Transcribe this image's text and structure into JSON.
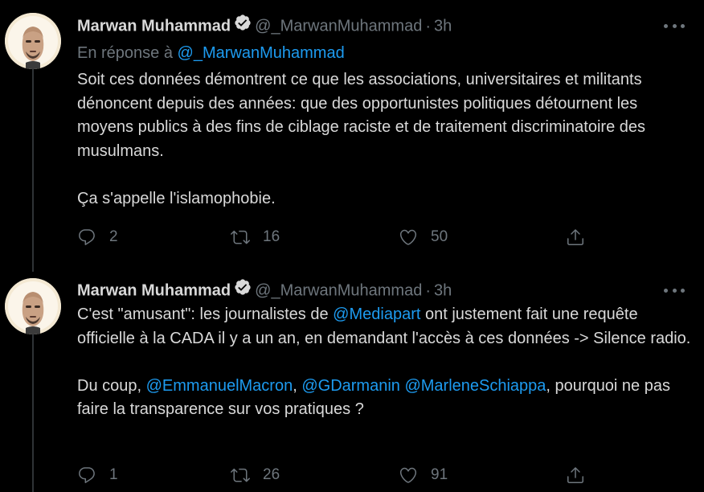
{
  "colors": {
    "background": "#000000",
    "text": "#d9d9d9",
    "muted": "#6e767d",
    "link": "#1d9bf0",
    "thread_line": "#2f3336"
  },
  "tweets": [
    {
      "display_name": "Marwan Muhammad",
      "handle": "@_MarwanMuhammad",
      "separator": "·",
      "time": "3h",
      "reply_prefix": "En réponse à",
      "reply_handle": "@_MarwanMuhammad",
      "text_p1": "Soit ces données démontrent ce que les associations, universitaires et militants dénoncent depuis des années: que des opportunistes politiques détournent les moyens publics à des fins de ciblage raciste et de traitement discriminatoire des musulmans.",
      "text_p2": "Ça s'appelle l'islamophobie.",
      "replies": "2",
      "retweets": "16",
      "likes": "50"
    },
    {
      "display_name": "Marwan Muhammad",
      "handle": "@_MarwanMuhammad",
      "separator": "·",
      "time": "3h",
      "text_a": "C'est \"amusant\": les journalistes de ",
      "mention_1": "@Mediapart",
      "text_b": " ont justement fait une requête officielle à la CADA il y a un an, en demandant l'accès à ces données -> Silence radio.",
      "text_c": "Du coup, ",
      "mention_2": "@EmmanuelMacron",
      "text_d": ", ",
      "mention_3": "@GDarmanin",
      "text_e": " ",
      "mention_4": "@MarleneSchiappa",
      "text_f": ", pourquoi ne pas faire la transparence sur vos pratiques ?",
      "replies": "1",
      "retweets": "26",
      "likes": "91"
    }
  ],
  "icons": {
    "verified": "verified-badge-icon",
    "more": "more-options-icon",
    "reply": "reply-icon",
    "retweet": "retweet-icon",
    "like": "heart-icon",
    "share": "share-icon",
    "avatar": "avatar"
  }
}
